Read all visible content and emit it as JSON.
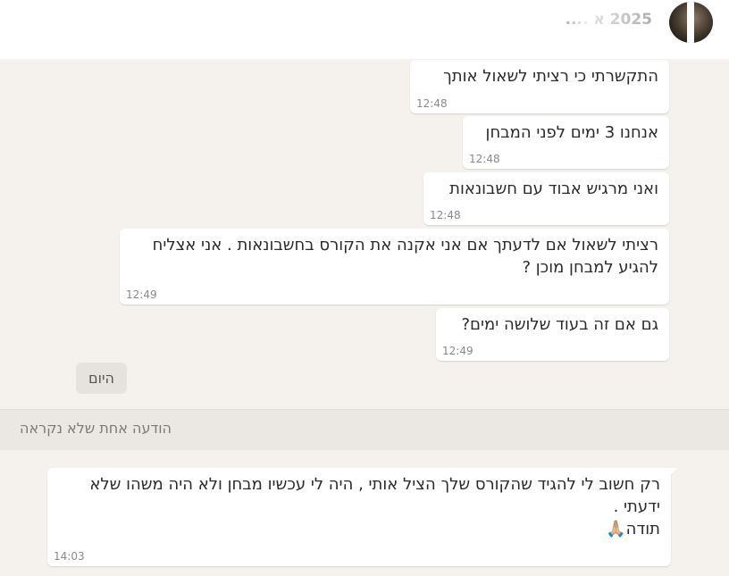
{
  "header": {
    "title": "2025 א ...."
  },
  "messages_outgoing": [
    {
      "text": "התקשרתי כי רציתי לשאול אותך",
      "time": "12:48"
    },
    {
      "text": "אנחנו 3 ימים לפני המבחן",
      "time": "12:48"
    },
    {
      "text": "ואני מרגיש אבוד עם חשבונאות",
      "time": "12:48"
    },
    {
      "text": "רציתי לשאול אם לדעתך אם אני אקנה את הקורס בחשבונאות . אני אצליח להגיע למבחן מוכן ?",
      "time": "12:49"
    },
    {
      "text": "גם אם זה בעוד שלושה ימים?",
      "time": "12:49"
    }
  ],
  "day_divider": "היום",
  "unread_divider": "הודעה אחת שלא נקראה",
  "message_incoming": {
    "text": "רק חשוב לי להגיד שהקורס שלך הציל אותי , היה לי עכשיו מבחן ולא היה משהו שלא ידעתי .",
    "thanks": "תודה🙏🏼",
    "time": "14:03"
  }
}
